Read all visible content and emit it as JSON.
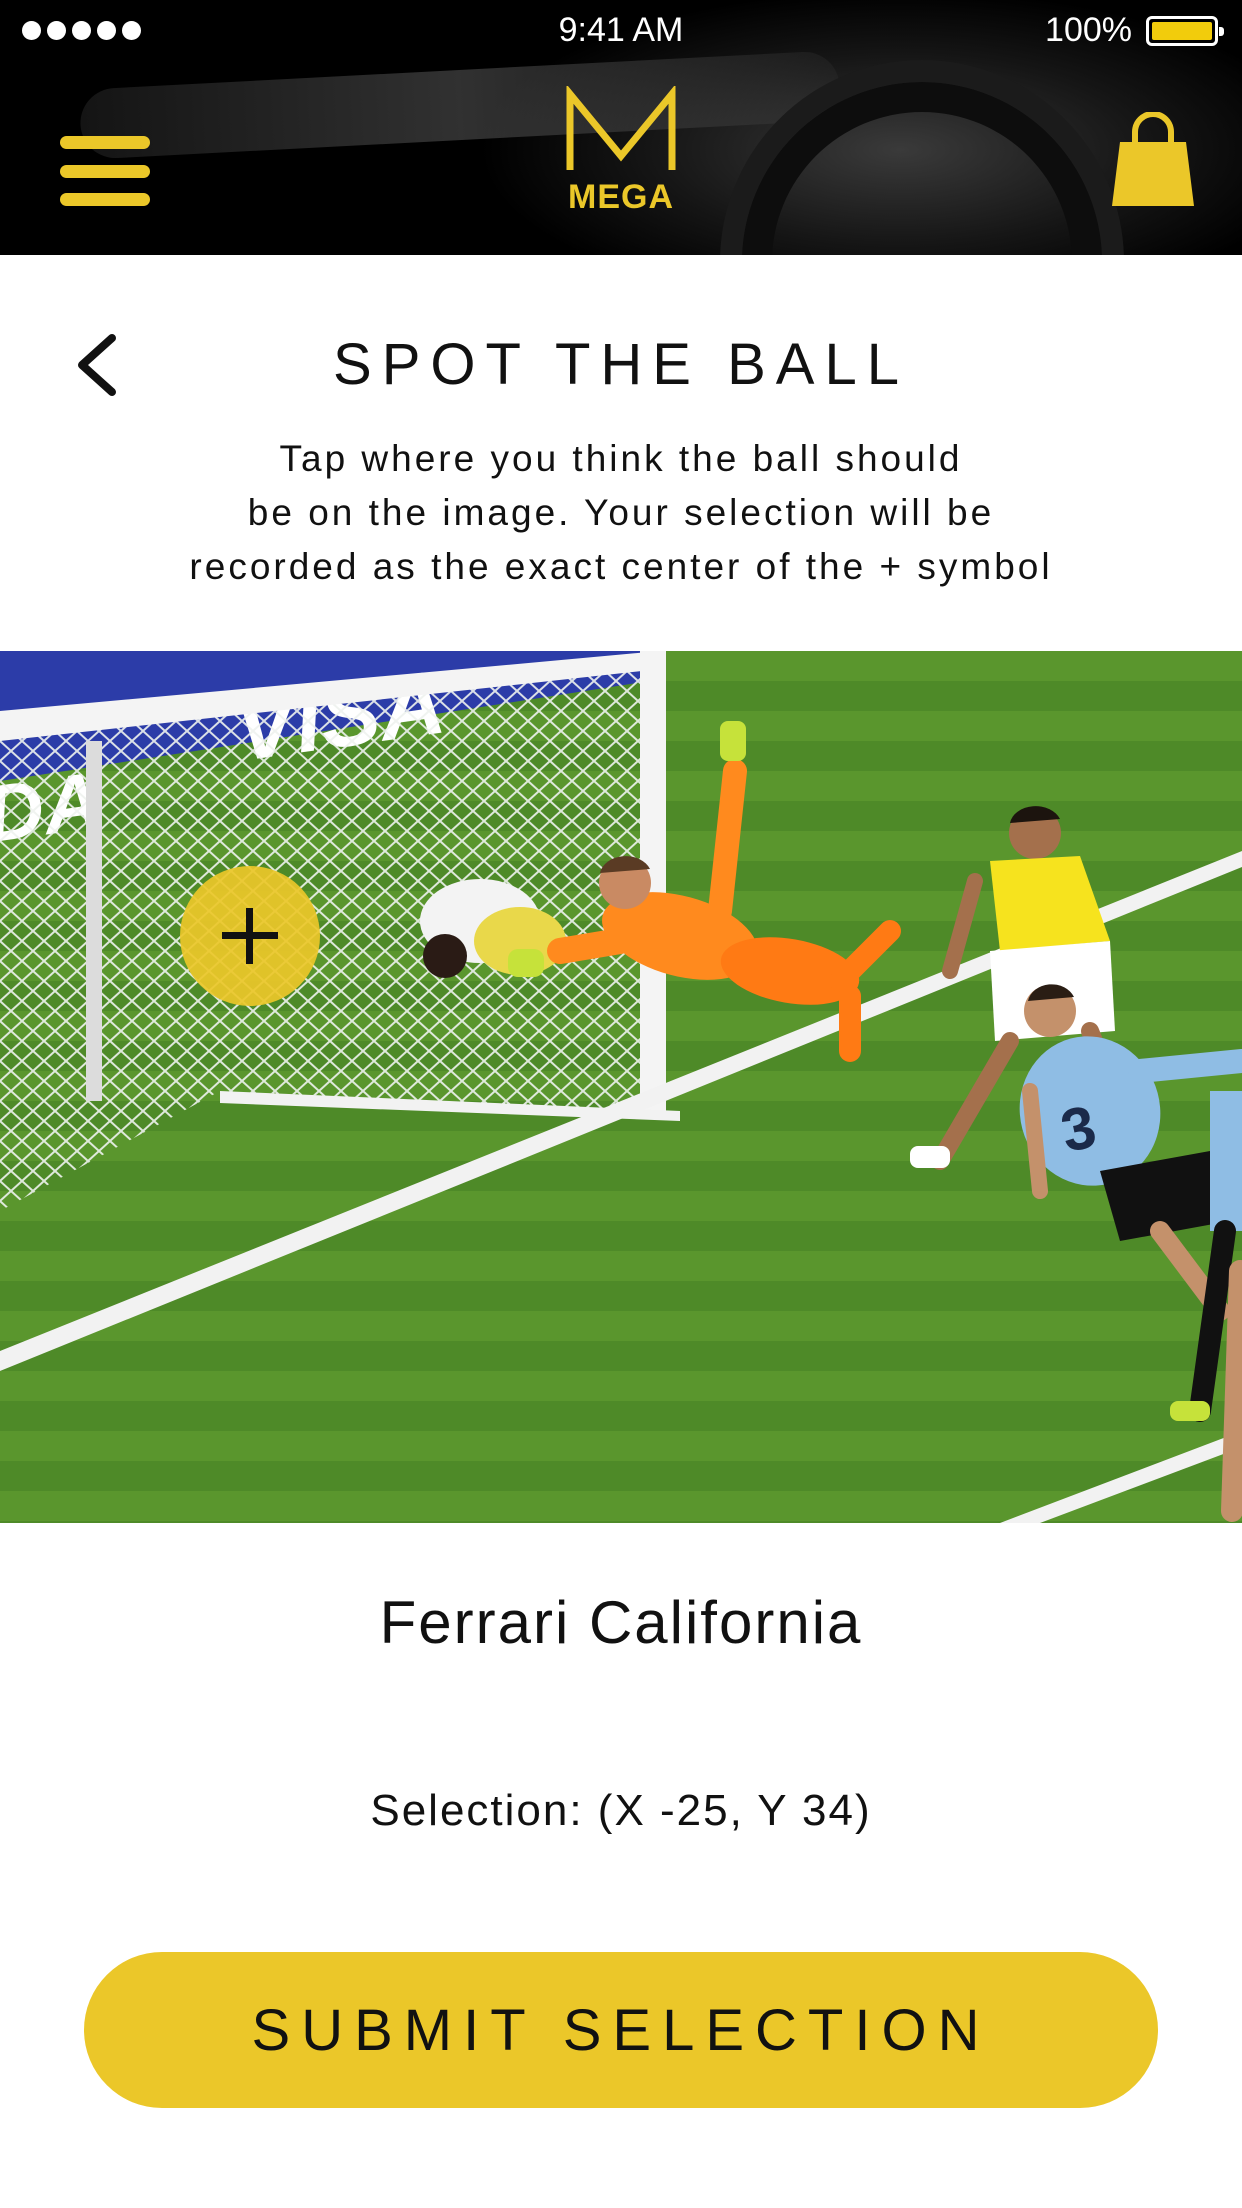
{
  "status_bar": {
    "time": "9:41 AM",
    "battery": "100%"
  },
  "header": {
    "logo_letter": "M",
    "logo_text": "MEGA",
    "accent_color": "#ebc729",
    "menu_icon": "hamburger-menu-icon",
    "cart_icon": "shopping-bag-icon"
  },
  "page": {
    "title": "SPOT THE BALL",
    "back_icon": "chevron-left-icon",
    "instructions": [
      "Tap where you think the ball should",
      "be on the image. Your selection will be",
      "recorded as the exact center of the + symbol"
    ]
  },
  "game": {
    "image_description": "football match photo",
    "marker_icon": "plus-icon",
    "prize": "Ferrari California",
    "selection_text": "Selection: (X -25, Y 34)"
  },
  "submit": {
    "label": "SUBMIT SELECTION"
  }
}
